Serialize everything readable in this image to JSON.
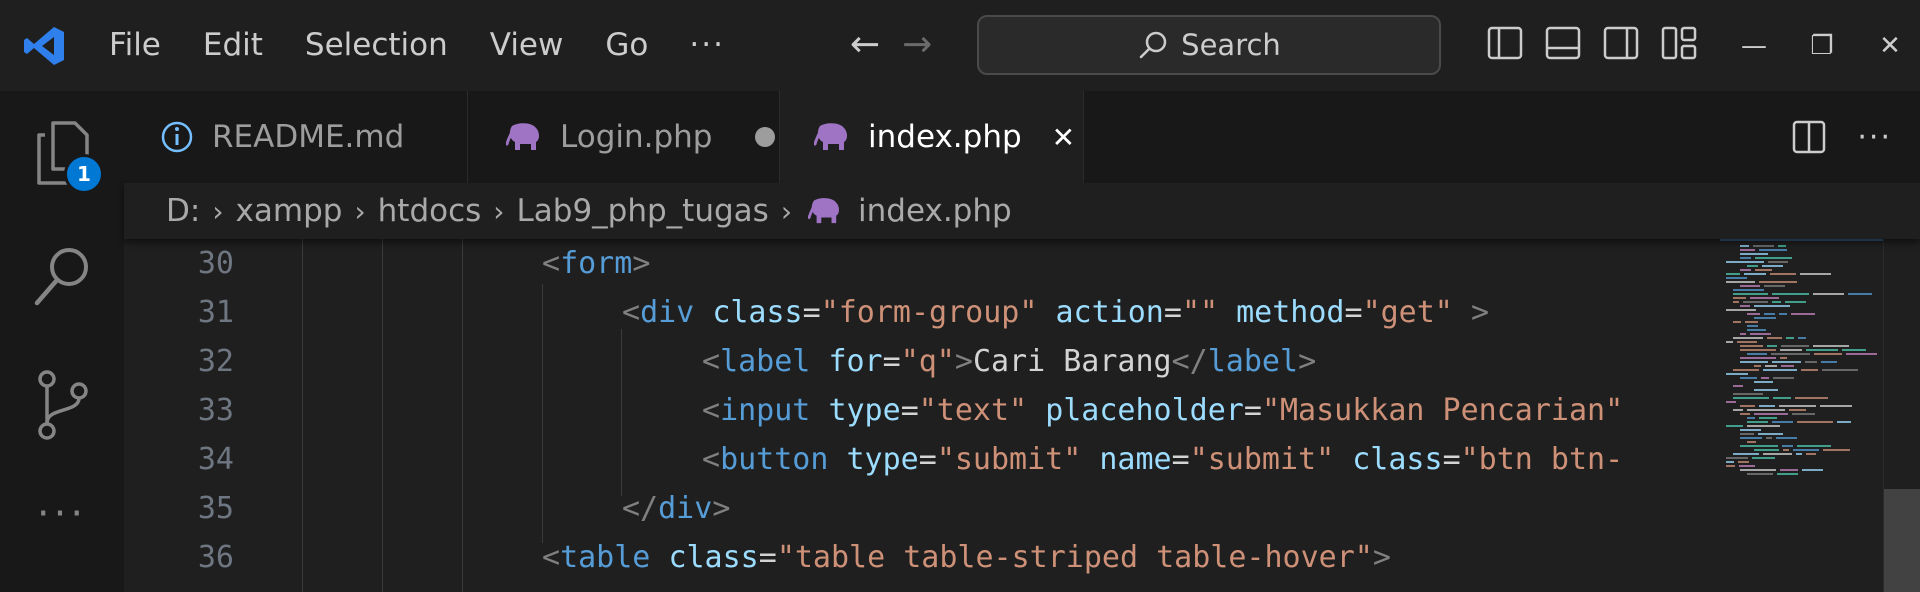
{
  "menu": {
    "items": [
      "File",
      "Edit",
      "Selection",
      "View",
      "Go"
    ],
    "more": "···"
  },
  "nav": {
    "back": "←",
    "forward": "→"
  },
  "search": {
    "label": "Search"
  },
  "window": {
    "minimize": "—",
    "restore": "❐",
    "close": "✕"
  },
  "activity": {
    "explorer_badge": "1",
    "more": "···"
  },
  "tabs": [
    {
      "title": "README.md",
      "icon": "info-icon",
      "state": "normal"
    },
    {
      "title": "Login.php",
      "icon": "php-elephant-icon",
      "state": "modified"
    },
    {
      "title": "index.php",
      "icon": "php-elephant-icon",
      "state": "active"
    }
  ],
  "tab_close": "✕",
  "breadcrumb": [
    "D:",
    "xampp",
    "htdocs",
    "Lab9_php_tugas",
    "index.php"
  ],
  "breadcrumb_sep": "›",
  "editor": {
    "lines": [
      {
        "n": "30",
        "indent": 0,
        "tokens": [
          [
            "punc",
            "<"
          ],
          [
            "tag",
            "form"
          ],
          [
            "punc",
            ">"
          ]
        ]
      },
      {
        "n": "31",
        "indent": 1,
        "tokens": [
          [
            "punc",
            "<"
          ],
          [
            "tag",
            "div"
          ],
          [
            "text",
            " "
          ],
          [
            "attr",
            "class"
          ],
          [
            "text",
            "="
          ],
          [
            "str",
            "\"form-group\""
          ],
          [
            "text",
            " "
          ],
          [
            "attr",
            "action"
          ],
          [
            "text",
            "="
          ],
          [
            "str",
            "\"\""
          ],
          [
            "text",
            " "
          ],
          [
            "attr",
            "method"
          ],
          [
            "text",
            "="
          ],
          [
            "str",
            "\"get\""
          ],
          [
            "text",
            " "
          ],
          [
            "punc",
            ">"
          ]
        ]
      },
      {
        "n": "32",
        "indent": 2,
        "tokens": [
          [
            "punc",
            "<"
          ],
          [
            "tag",
            "label"
          ],
          [
            "text",
            " "
          ],
          [
            "attr",
            "for"
          ],
          [
            "text",
            "="
          ],
          [
            "str",
            "\"q\""
          ],
          [
            "punc",
            ">"
          ],
          [
            "text",
            "Cari Barang"
          ],
          [
            "punc",
            "</"
          ],
          [
            "tag",
            "label"
          ],
          [
            "punc",
            ">"
          ]
        ]
      },
      {
        "n": "33",
        "indent": 2,
        "tokens": [
          [
            "punc",
            "<"
          ],
          [
            "tag",
            "input"
          ],
          [
            "text",
            " "
          ],
          [
            "attr",
            "type"
          ],
          [
            "text",
            "="
          ],
          [
            "str",
            "\"text\""
          ],
          [
            "text",
            " "
          ],
          [
            "attr",
            "placeholder"
          ],
          [
            "text",
            "="
          ],
          [
            "str",
            "\"Masukkan Pencarian\""
          ]
        ]
      },
      {
        "n": "34",
        "indent": 2,
        "tokens": [
          [
            "punc",
            "<"
          ],
          [
            "tag",
            "button"
          ],
          [
            "text",
            " "
          ],
          [
            "attr",
            "type"
          ],
          [
            "text",
            "="
          ],
          [
            "str",
            "\"submit\""
          ],
          [
            "text",
            " "
          ],
          [
            "attr",
            "name"
          ],
          [
            "text",
            "="
          ],
          [
            "str",
            "\"submit\""
          ],
          [
            "text",
            " "
          ],
          [
            "attr",
            "class"
          ],
          [
            "text",
            "="
          ],
          [
            "str",
            "\"btn btn-"
          ]
        ]
      },
      {
        "n": "35",
        "indent": 1,
        "tokens": [
          [
            "punc",
            "</"
          ],
          [
            "tag",
            "div"
          ],
          [
            "punc",
            ">"
          ]
        ]
      },
      {
        "n": "36",
        "indent": 0,
        "tokens": [
          [
            "punc",
            "<"
          ],
          [
            "tag",
            "table"
          ],
          [
            "text",
            " "
          ],
          [
            "attr",
            "class"
          ],
          [
            "text",
            "="
          ],
          [
            "str",
            "\"table table-striped table-hover\""
          ],
          [
            "punc",
            ">"
          ]
        ]
      }
    ]
  },
  "colors": {
    "tag": "#569cd6",
    "attr": "#9cdcfe",
    "string": "#ce9178",
    "text": "#d4d4d4",
    "punctuation": "#808080",
    "accent": "#0078d4",
    "php_icon": "#a074c4",
    "vscode_logo": "#2f80ed"
  }
}
